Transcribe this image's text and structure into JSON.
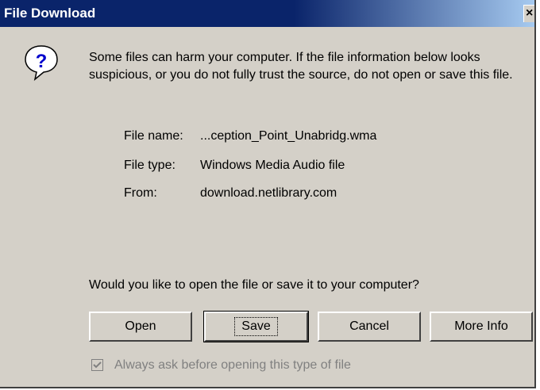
{
  "window": {
    "title": "File Download",
    "close_glyph": "×"
  },
  "icon": {
    "name": "question-icon",
    "glyph": "?"
  },
  "message": "Some files can harm your computer. If the file information below looks suspicious, or you do not fully trust the source, do not open or save this file.",
  "file_info": {
    "name_label": "File name:",
    "name_value": "...ception_Point_Unabridg.wma",
    "type_label": "File type:",
    "type_value": "Windows Media Audio file",
    "from_label": "From:",
    "from_value": "download.netlibrary.com"
  },
  "question": "Would you like to open the file or save it to your computer?",
  "buttons": {
    "open": "Open",
    "save": "Save",
    "cancel": "Cancel",
    "more_info": "More Info"
  },
  "checkbox": {
    "label": "Always ask before opening this type of file",
    "checked": true,
    "disabled": true
  },
  "colors": {
    "titlebar_start": "#0a246a",
    "titlebar_end": "#a6caf0",
    "face": "#d4d0c8",
    "disabled_text": "#808080"
  }
}
